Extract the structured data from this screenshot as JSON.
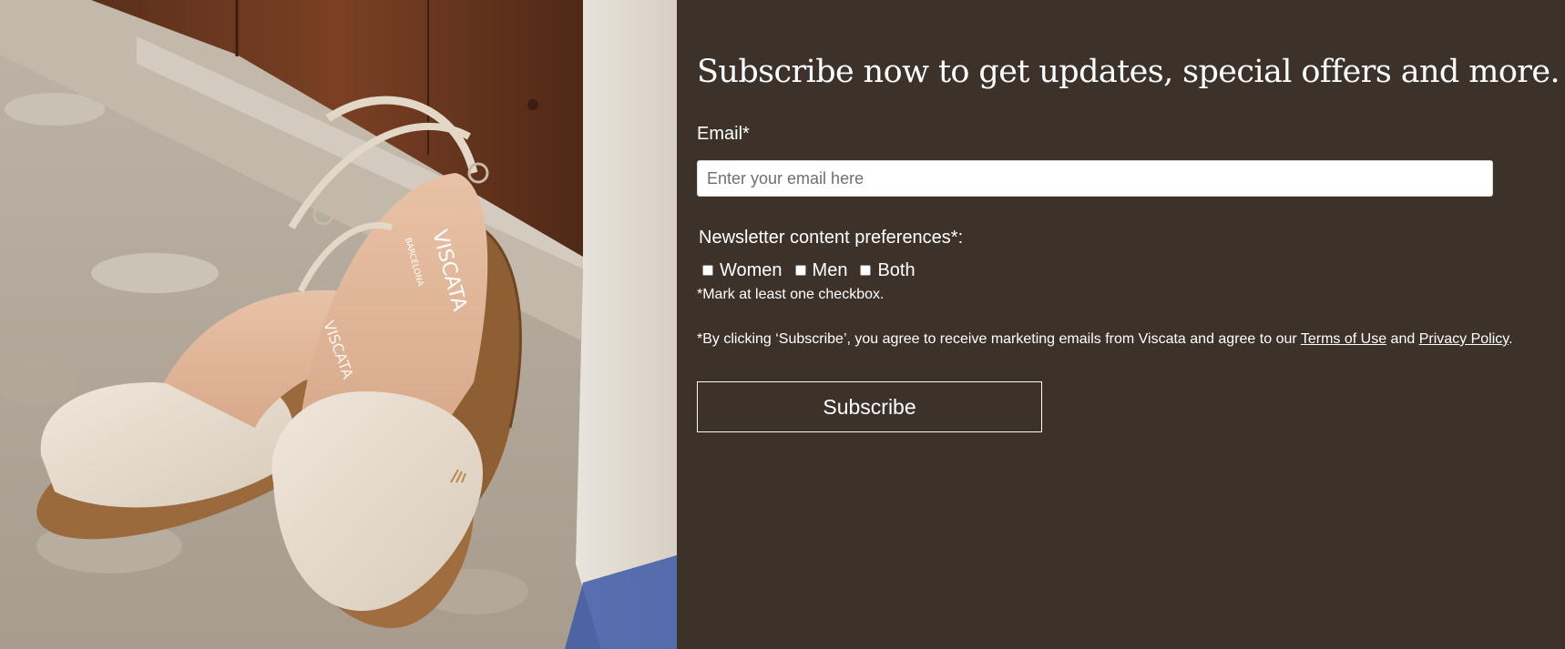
{
  "hero": {
    "brand_on_insole": "VISCATA",
    "brand_subline": "BARCELONA"
  },
  "form": {
    "heading": "Subscribe now to get updates, special offers and more.",
    "email_label": "Email*",
    "email_placeholder": "Enter your email here",
    "email_value": "",
    "preferences_label": "Newsletter content preferences*:",
    "options": [
      {
        "label": "Women",
        "checked": false
      },
      {
        "label": "Men",
        "checked": false
      },
      {
        "label": "Both",
        "checked": false
      }
    ],
    "hint": "*Mark at least one checkbox.",
    "legal": {
      "prefix": "*By clicking ‘Subscribe’, you agree to receive marketing emails from Viscata and agree to our ",
      "terms_link": "Terms of Use",
      "middle": " and ",
      "privacy_link": "Privacy Policy",
      "suffix": "."
    },
    "submit_label": "Subscribe"
  },
  "colors": {
    "panel_background": "#3d322a",
    "text": "#ffffff",
    "input_background": "#ffffff"
  }
}
